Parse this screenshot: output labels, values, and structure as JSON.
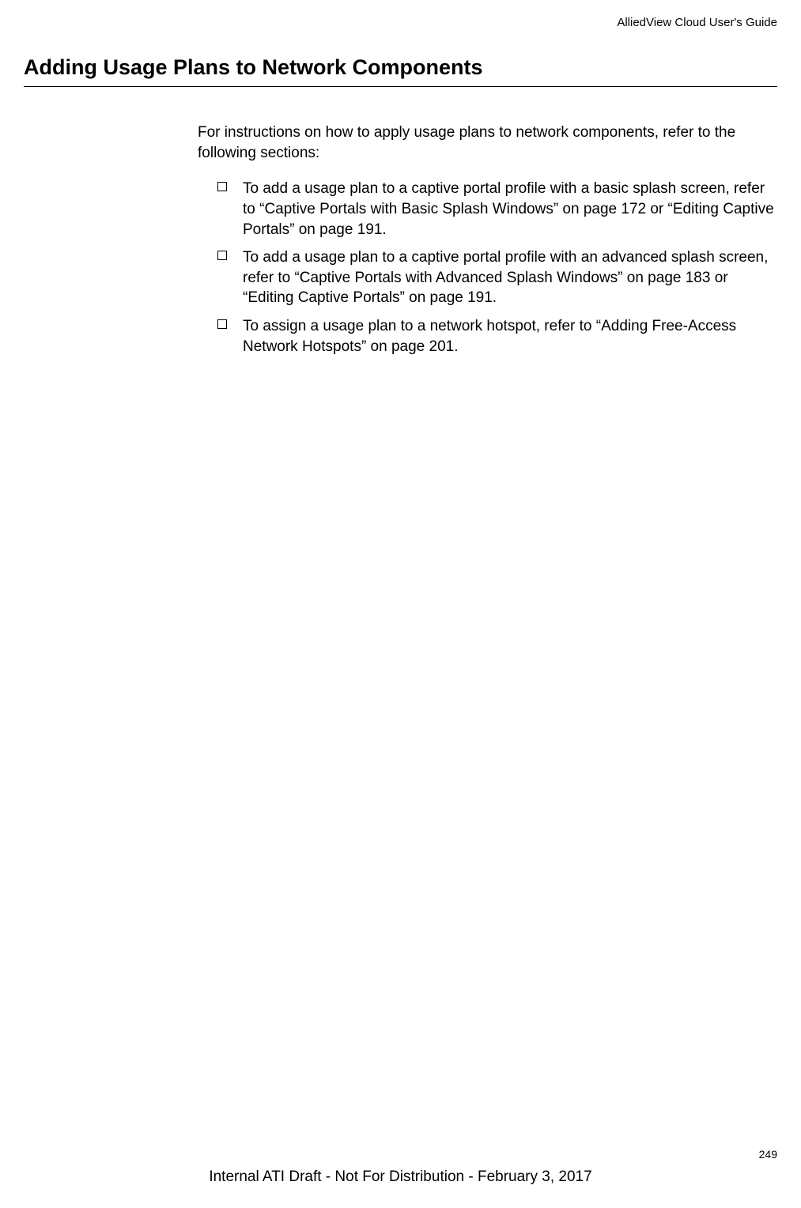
{
  "header": {
    "document_title": "AlliedView Cloud User's Guide"
  },
  "section": {
    "heading": "Adding Usage Plans to Network Components",
    "intro": "For instructions on how to apply usage plans to network components, refer to the following sections:",
    "bullets": [
      "To add a usage plan to a captive portal profile with a basic splash screen, refer to “Captive Portals with Basic Splash Windows” on page 172 or “Editing Captive Portals” on page 191.",
      "To add a usage plan to a captive portal profile with an advanced splash screen, refer to “Captive Portals with Advanced Splash Windows” on page 183 or “Editing Captive Portals” on page 191.",
      "To assign a usage plan to a network hotspot, refer to “Adding Free-Access Network Hotspots” on page 201."
    ]
  },
  "footer": {
    "page_number": "249",
    "distribution_notice": "Internal ATI Draft - Not For Distribution - February 3, 2017"
  }
}
